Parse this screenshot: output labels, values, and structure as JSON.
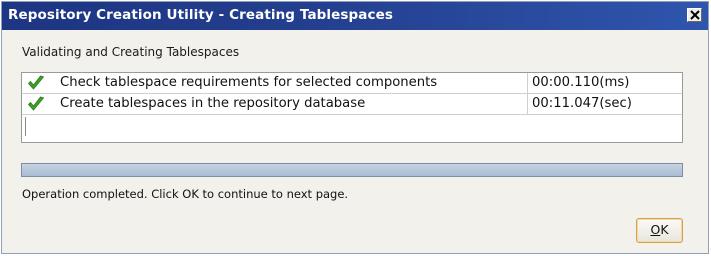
{
  "window": {
    "title": "Repository Creation Utility - Creating Tablespaces",
    "close_icon": "close-x-icon"
  },
  "section_label": "Validating and Creating Tablespaces",
  "tasks": [
    {
      "status_icon": "green-check-icon",
      "name": "Check tablespace requirements for selected components",
      "time": "00:00.110(ms)"
    },
    {
      "status_icon": "green-check-icon",
      "name": "Create tablespaces in the repository database",
      "time": "00:11.047(sec)"
    }
  ],
  "progress": {
    "fraction": 1.0
  },
  "status_message": "Operation completed. Click OK to continue to next page.",
  "ok_button": {
    "mnemonic": "O",
    "rest": "K"
  },
  "colors": {
    "titlebar": "#1d3582",
    "check": "#3fa12a",
    "ok_border": "#d4a24a",
    "progress_fill": "#a9bcd3"
  }
}
